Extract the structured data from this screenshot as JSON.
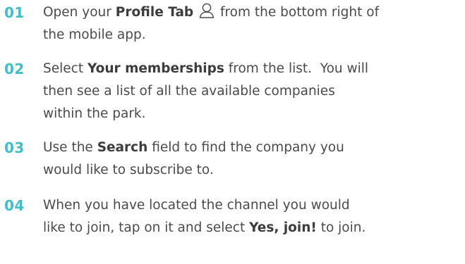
{
  "steps": [
    {
      "number": "01",
      "lines": [
        {
          "pre": "Open your ",
          "bold": "Profile Tab",
          "post": " from the bottom right of"
        },
        {
          "text": "the mobile app."
        }
      ],
      "icon": "user-profile-icon"
    },
    {
      "number": "02",
      "lines": [
        {
          "pre": "Select ",
          "bold": "Your memberships",
          "post": " from the list.  You will"
        },
        {
          "text": "then see a list of all the available companies"
        },
        {
          "text": "within the park."
        }
      ]
    },
    {
      "number": "03",
      "lines": [
        {
          "pre": "Use the ",
          "bold": "Search",
          "post": " field to find the company you"
        },
        {
          "text": "would like to subscribe to."
        }
      ]
    },
    {
      "number": "04",
      "lines": [
        {
          "text": "When you have located the channel you would"
        },
        {
          "pre": "like to join, tap on it and select ",
          "bold": "Yes, join!",
          "post": " to join."
        }
      ]
    }
  ],
  "colors": {
    "accent": "#3fbfc7",
    "body_text": "#4a4a4a"
  }
}
